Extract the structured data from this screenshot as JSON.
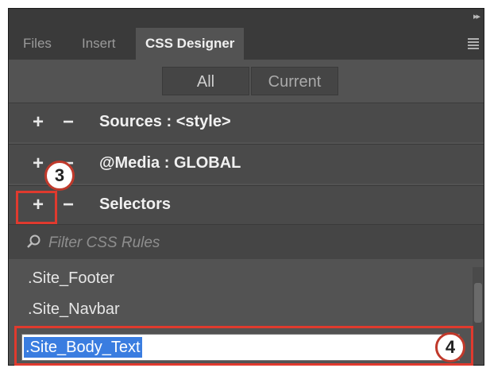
{
  "panel": {
    "tabs": [
      {
        "label": "Files"
      },
      {
        "label": "Insert"
      },
      {
        "label": "CSS Designer"
      }
    ],
    "segments": [
      {
        "label": "All"
      },
      {
        "label": "Current"
      }
    ],
    "sections": [
      {
        "plus": "+",
        "minus": "−",
        "label": "Sources :  <style>"
      },
      {
        "plus": "+",
        "minus": "−",
        "label": "@Media :  GLOBAL"
      },
      {
        "plus": "+",
        "minus": "−",
        "label": "Selectors"
      }
    ],
    "filter": {
      "placeholder": "Filter CSS Rules",
      "value": ""
    },
    "selectors": [
      {
        "label": ".Site_Footer"
      },
      {
        "label": ".Site_Navbar"
      }
    ],
    "editing_selector": ".Site_Body_Text"
  },
  "callouts": [
    {
      "number": "3"
    },
    {
      "number": "4"
    }
  ],
  "colors": {
    "panel_bg": "#535353",
    "tab_bar_bg": "#3a3a3a",
    "selection_blue": "#3a7de0",
    "callout_red": "#e03a2e"
  },
  "icons": [
    "collapse-panel-icon",
    "panel-menu-icon",
    "search-icon"
  ]
}
